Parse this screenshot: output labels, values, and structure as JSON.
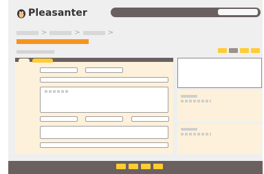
{
  "app": {
    "name": "Pleasanter"
  },
  "colors": {
    "accent": "#f7941d",
    "highlight": "#ffcc33",
    "dark_bar": "#6a6060",
    "panel_bg": "#fdf1db"
  },
  "icons": {
    "logo": "penguin-logo-icon"
  },
  "header": {
    "search_placeholder": ""
  },
  "breadcrumb": {
    "separator": ">"
  }
}
